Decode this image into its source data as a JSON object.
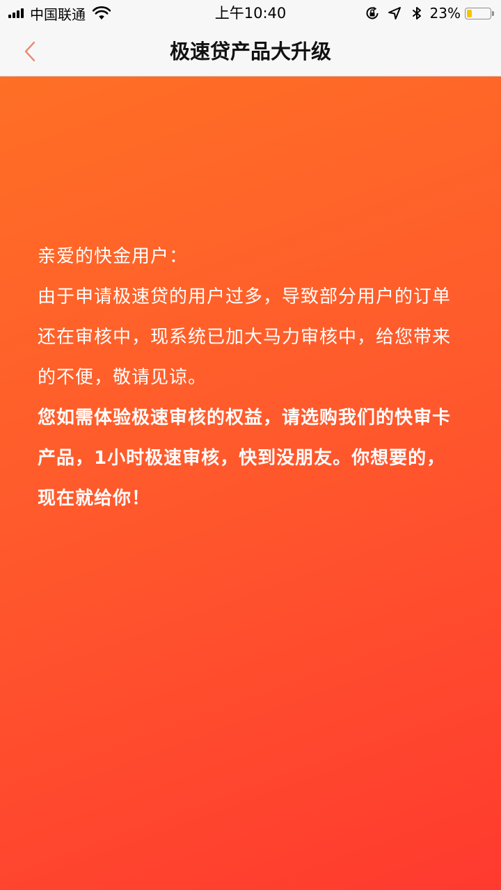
{
  "status_bar": {
    "carrier": "中国联通",
    "time": "上午10:40",
    "battery_percent": "23%",
    "battery_level": 0.23
  },
  "nav": {
    "title": "极速贷产品大升级",
    "back_icon": "chevron-left-icon"
  },
  "message": {
    "greeting": "亲爱的快金用户：",
    "notice": "由于申请极速贷的用户过多，导致部分用户的订单还在审核中，现系统已加大马力审核中，给您带来的不便，敬请见谅。",
    "promo": "您如需体验极速审核的权益，请选购我们的快审卡产品，1小时极速审核，快到没朋友。你想要的，现在就给你！"
  },
  "colors": {
    "gradient_start": "#ff6f25",
    "gradient_end": "#ff3a2f",
    "back_icon": "#e98b72"
  }
}
